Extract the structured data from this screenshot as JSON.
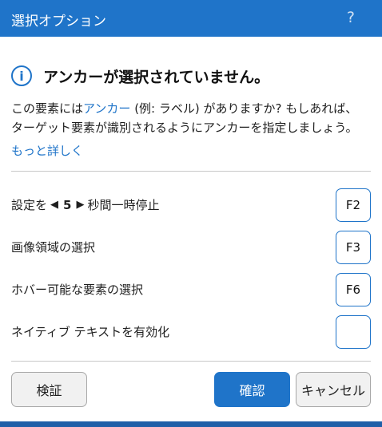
{
  "window": {
    "title": "選択オプション",
    "help": "?"
  },
  "heading": {
    "icon": "info-icon",
    "text": "アンカーが選択されていません。"
  },
  "description": {
    "line1_pre": "この要素には",
    "line1_link": "アンカー",
    "line1_post": " (例: ラベル) がありますか? もしあれば、",
    "line2": "ターゲット要素が識別されるようにアンカーを指定しましょう。",
    "more_link": "もっと詳しく"
  },
  "options": [
    {
      "label_pre": "設定を ",
      "value": "5",
      "label_post": " 秒間一時停止",
      "key": "F2"
    },
    {
      "label": "画像領域の選択",
      "key": "F3"
    },
    {
      "label": "ホバー可能な要素の選択",
      "key": "F6"
    },
    {
      "label": "ネイティブ テキストを有効化",
      "key": ""
    }
  ],
  "buttons": {
    "verify": "検証",
    "confirm": "確認",
    "cancel": "キャンセル"
  },
  "colors": {
    "accent": "#1f74c9",
    "titlebar": "#1f74c9"
  }
}
